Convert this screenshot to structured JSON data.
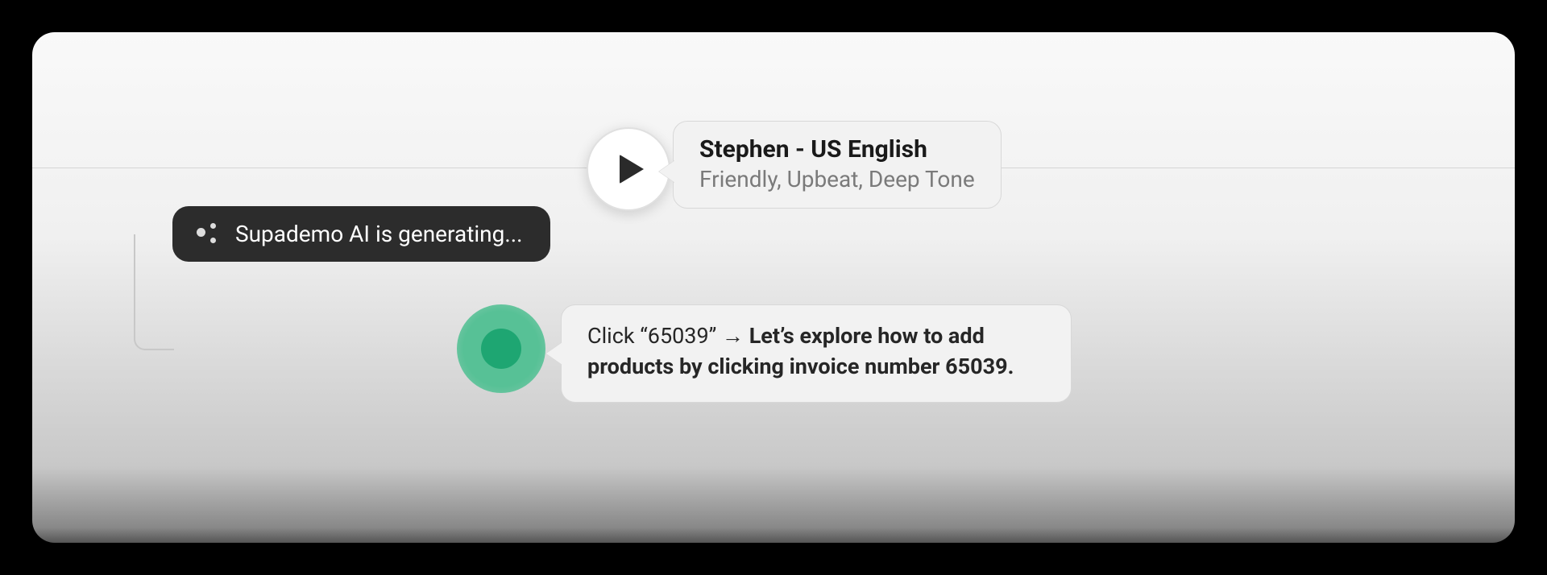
{
  "voice": {
    "name": "Stephen - US English",
    "description": "Friendly, Upbeat, Deep Tone"
  },
  "generating": {
    "label": "Supademo AI is generating..."
  },
  "step": {
    "prefix": "Click “65039”",
    "arrow": "→",
    "bold": "Let’s explore how to add products by clicking invoice number 65039."
  }
}
